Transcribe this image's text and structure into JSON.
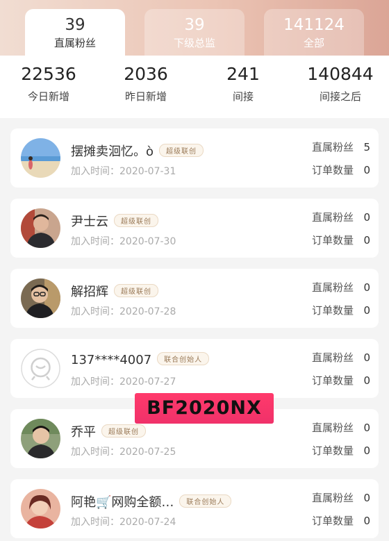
{
  "tabs": [
    {
      "count": "39",
      "label": "直属粉丝",
      "active": true
    },
    {
      "count": "39",
      "label": "下级总监",
      "active": false
    },
    {
      "count": "141124",
      "label": "全部",
      "active": false
    }
  ],
  "stats": [
    {
      "value": "22536",
      "label": "今日新增"
    },
    {
      "value": "2036",
      "label": "昨日新增"
    },
    {
      "value": "241",
      "label": "间接"
    },
    {
      "value": "140844",
      "label": "间接之后"
    }
  ],
  "members": [
    {
      "name": "摆摊卖洄忆。ò",
      "badge": "超级联创",
      "join": "加入时间：2020-07-31",
      "fans_label": "直属粉丝",
      "fans": "5",
      "orders_label": "订单数量",
      "orders": "0"
    },
    {
      "name": "尹士云",
      "badge": "超级联创",
      "join": "加入时间：2020-07-30",
      "fans_label": "直属粉丝",
      "fans": "0",
      "orders_label": "订单数量",
      "orders": "0"
    },
    {
      "name": "解招辉",
      "badge": "超级联创",
      "join": "加入时间：2020-07-28",
      "fans_label": "直属粉丝",
      "fans": "0",
      "orders_label": "订单数量",
      "orders": "0"
    },
    {
      "name": "137****4007",
      "badge": "联合创始人",
      "join": "加入时间：2020-07-27",
      "fans_label": "直属粉丝",
      "fans": "0",
      "orders_label": "订单数量",
      "orders": "0"
    },
    {
      "name": "乔平",
      "badge": "超级联创",
      "join": "加入时间：2020-07-25",
      "fans_label": "直属粉丝",
      "fans": "0",
      "orders_label": "订单数量",
      "orders": "0"
    },
    {
      "name": "阿艳🛒网购全额…",
      "badge": "联合创始人",
      "join": "加入时间：2020-07-24",
      "fans_label": "直属粉丝",
      "fans": "0",
      "orders_label": "订单数量",
      "orders": "0"
    }
  ],
  "watermark": "BF2020NX",
  "colors": {
    "accent_band": "#ebc4b4",
    "badge_text": "#9a7a58",
    "watermark_bg": "#f0316a"
  }
}
